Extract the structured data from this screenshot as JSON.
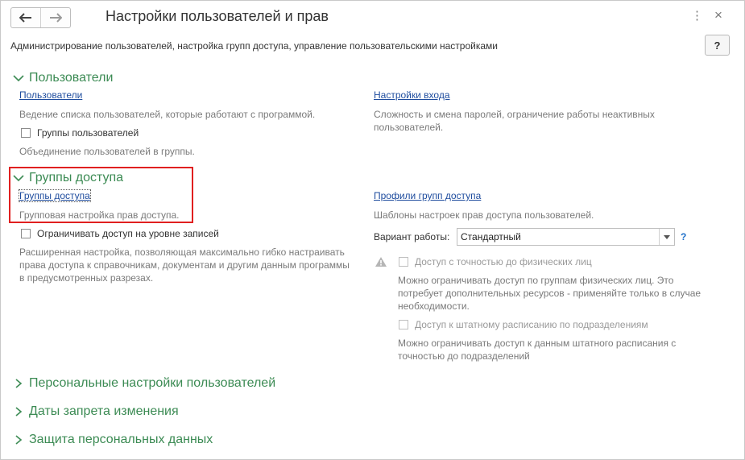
{
  "window": {
    "title": "Настройки пользователей и прав",
    "description": "Администрирование пользователей, настройка групп доступа, управление пользовательскими настройками",
    "help_label": "?",
    "menu_glyph": "⋮",
    "close_glyph": "×"
  },
  "users": {
    "title": "Пользователи",
    "users_link": "Пользователи",
    "users_note": "Ведение списка пользователей, которые работают с программой.",
    "user_groups_checkbox": "Группы пользователей",
    "user_groups_note": "Объединение пользователей в группы.",
    "login_settings_link": "Настройки входа",
    "login_settings_note": "Сложность и смена паролей, ограничение работы неактивных пользователей."
  },
  "access_groups": {
    "title": "Группы доступа",
    "access_groups_link": "Группы доступа",
    "access_groups_note": "Групповая настройка прав доступа.",
    "record_level_checkbox": "Ограничивать доступ на уровне записей",
    "record_level_note": "Расширенная настройка, позволяющая максимально гибко настраивать права доступа к справочникам, документам и другим данным программы в предусмотренных разрезах.",
    "profiles_link": "Профили групп доступа",
    "profiles_note": "Шаблоны настроек прав доступа пользователей.",
    "mode_label": "Вариант работы:",
    "mode_value": "Стандартный",
    "mode_help": "?",
    "individuals_checkbox": "Доступ с точностью до физических лиц",
    "individuals_note": "Можно ограничивать доступ по группам физических лиц. Это потребует дополнительных ресурсов - применяйте только в случае необходимости.",
    "staff_checkbox": "Доступ к штатному расписанию по подразделениям",
    "staff_note": "Можно ограничивать доступ к данным штатного расписания с точностью до подразделений"
  },
  "collapsed_sections": {
    "personal": "Персональные настройки пользователей",
    "dates": "Даты запрета изменения",
    "protection": "Защита персональных данных"
  },
  "colors": {
    "section_green": "#3c8b54",
    "link_blue": "#1e4c9e",
    "highlight_red": "#e02020"
  }
}
